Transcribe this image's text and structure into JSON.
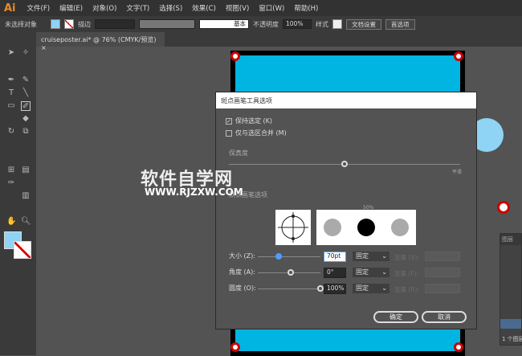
{
  "app": {
    "logo": "Ai"
  },
  "menu": [
    "文件(F)",
    "编辑(E)",
    "对象(O)",
    "文字(T)",
    "选择(S)",
    "效果(C)",
    "视图(V)",
    "窗口(W)",
    "帮助(H)"
  ],
  "control": {
    "selection": "未选择对象",
    "stroke_label": "描边",
    "stroke_style": "基本",
    "opacity_label": "不透明度",
    "opacity": "100%",
    "style_label": "样式",
    "doc_settings": "文档设置",
    "preferences": "首选项"
  },
  "tab": {
    "title": "cruiseposter.ai* @ 76% (CMYK/预览)",
    "close": "×"
  },
  "dialog": {
    "title": "斑点画笔工具选项",
    "keep_selected": {
      "label": "保持选定 (K)",
      "checked": true
    },
    "merge_only": {
      "label": "仅与选区合并 (M)",
      "checked": false
    },
    "fidelity_label": "保真度",
    "fidelity_right": "平滑",
    "fidelity_value": 0.5,
    "brush_section": "默认画笔选项",
    "preview_pct": "50%",
    "rows": [
      {
        "label": "大小 (Z):",
        "value": "70pt",
        "mode": "固定",
        "var_label": "变量 (V):",
        "slider": 0.3
      },
      {
        "label": "角度 (A):",
        "value": "0°",
        "mode": "固定",
        "var_label": "变量 (F):",
        "slider": 0.5
      },
      {
        "label": "圆度 (O):",
        "value": "100%",
        "mode": "固定",
        "var_label": "变量 (R):",
        "slider": 1.0
      }
    ],
    "ok": "确定",
    "cancel": "取消"
  },
  "watermark": {
    "line1": "软件自学网",
    "line2": "WWW.RJZXW.COM"
  },
  "layers": {
    "title": "图层",
    "footer": "1 个图层"
  },
  "colors": {
    "artboard": "#00b5e2",
    "fill": "#8fd3f5",
    "accent": "#4a9fff"
  }
}
